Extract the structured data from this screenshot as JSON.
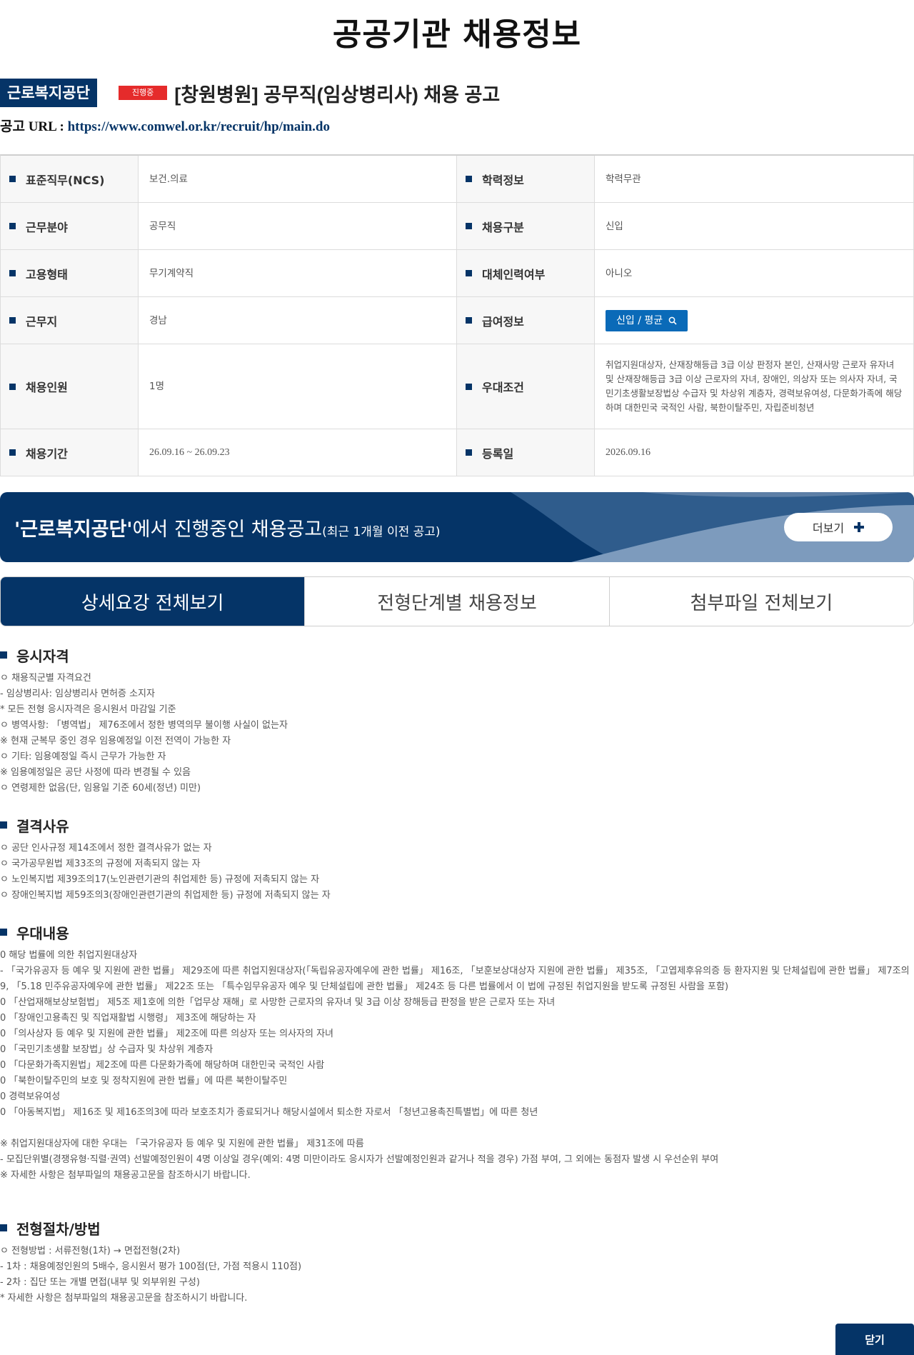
{
  "page_title": "공공기관 채용정보",
  "header": {
    "org_name": "근로복지공단",
    "status": "진행중",
    "job_title": "[창원병원] 공무직(임상병리사) 채용 공고",
    "url_label": "공고 URL : ",
    "url": "https://www.comwel.or.kr/recruit/hp/main.do"
  },
  "info": {
    "rows": [
      {
        "left_label": "표준직무(NCS)",
        "left_value": "보건.의료",
        "right_label": "학력정보",
        "right_value": "학력무관"
      },
      {
        "left_label": "근무분야",
        "left_value": "공무직",
        "right_label": "채용구분",
        "right_value": "신입"
      },
      {
        "left_label": "고용형태",
        "left_value": "무기계약직",
        "right_label": "대체인력여부",
        "right_value": "아니오"
      },
      {
        "left_label": "근무지",
        "left_value": "경남",
        "right_label": "급여정보",
        "right_value": "신입 / 평균"
      },
      {
        "left_label": "채용인원",
        "left_value": "1명",
        "right_label": "우대조건",
        "right_value": "취업지원대상자, 산재장해등급 3급 이상 판정자 본인, 산재사망 근로자 유자녀 및 산재장해등급 3급 이상 근로자의 자녀, 장애인, 의상자 또는 의사자 자녀, 국민기초생활보장법상 수급자 및 차상위 계층자, 경력보유여성, 다문화가족에 해당하며 대한민국 국적인 사람, 북한이탈주민, 자립준비청년"
      },
      {
        "left_label": "채용기간",
        "left_value": "26.09.16 ~ 26.09.23",
        "right_label": "등록일",
        "right_value": "2026.09.16"
      }
    ]
  },
  "banner": {
    "org_quoted": "'근로복지공단'",
    "text": "에서 진행중인 채용공고",
    "note": "(최근 1개월 이전 공고)",
    "more_label": "더보기"
  },
  "tabs": [
    {
      "label": "상세요강 전체보기",
      "active": true
    },
    {
      "label": "전형단계별 채용정보",
      "active": false
    },
    {
      "label": "첨부파일 전체보기",
      "active": false
    }
  ],
  "sections": {
    "qualification": {
      "title": "응시자격",
      "lines": [
        "ㅇ 채용직군별 자격요건",
        "- 임상병리사: 임상병리사 면허증 소지자",
        "* 모든 전형 응시자격은 응시원서 마감일 기준",
        "ㅇ 병역사항: 「병역법」 제76조에서 정한 병역의무 불이행 사실이 없는자",
        "※ 현재 군복무 중인 경우 임용예정일 이전 전역이 가능한 자",
        "ㅇ 기타: 임용예정일 즉시 근무가 가능한 자",
        "※ 임용예정일은 공단 사정에 따라 변경될 수 있음",
        "ㅇ 연령제한 없음(단, 임용일 기준 60세(정년) 미만)"
      ]
    },
    "disqualification": {
      "title": "결격사유",
      "lines": [
        "ㅇ 공단 인사규정 제14조에서 정한 결격사유가 없는 자",
        "ㅇ 국가공무원법 제33조의 규정에 저촉되지 않는 자",
        "ㅇ 노인복지법 제39조의17(노인관련기관의 취업제한 등) 규정에 저촉되지 않는 자",
        "ㅇ 장애인복지법 제59조의3(장애인관련기관의 취업제한 등) 규정에 저촉되지 않는 자"
      ]
    },
    "preference": {
      "title": "우대내용",
      "lines": [
        "0 해당 법률에 의한 취업지원대상자",
        "- 「국가유공자 등 예우 및 지원에 관한 법률」 제29조에 따른 취업지원대상자(「독립유공자예우에 관한 법률」 제16조, 「보훈보상대상자 지원에 관한 법률」 제35조, 「고엽제후유의증 등 환자지원 및 단체설립에 관한 법률」 제7조의9, 「5.18 민주유공자예우에 관한 법률」 제22조 또는 「특수임무유공자 예우 및 단체설립에 관한 법률」 제24조 등 다른 법률에서 이 법에 규정된 취업지원을 받도록 규정된 사람을 포함)",
        "0 「산업재해보상보험법」 제5조 제1호에 의한「업무상 재해」로 사망한 근로자의 유자녀 및 3급 이상 장해등급 판정을 받은 근로자 또는 자녀",
        "0 「장애인고용촉진 및 직업재활법 시행령」 제3조에 해당하는 자",
        "0 「의사상자 등 예우 및 지원에 관한 법률」 제2조에 따른 의상자 또는 의사자의 자녀",
        "0 「국민기초생활 보장법」상 수급자 및 차상위 계층자",
        "0 「다문화가족지원법」제2조에 따른 다문화가족에 해당하며 대한민국 국적인 사람",
        "0 「북한이탈주민의 보호 및 정착지원에 관한 법률」에 따른 북한이탈주민",
        "0 경력보유여성",
        "0 「아동복지법」 제16조 및 제16조의3에 따라 보호조치가 종료되거나 해당시설에서 퇴소한 자로서 「청년고용촉진특별법」에 따른 청년",
        "",
        "※ 취업지원대상자에 대한 우대는 「국가유공자 등 예우 및 지원에 관한 법률」 제31조에 따름",
        "- 모집단위별(경쟁유형·직렬·권역) 선발예정인원이 4명 이상일 경우(예외: 4명 미만이라도 응시자가 선발예정인원과 같거나 적을 경우) 가점 부여, 그 외에는 동점자 발생 시 우선순위 부여",
        "※ 자세한 사항은 첨부파일의 채용공고문을 참조하시기 바랍니다."
      ]
    },
    "procedure": {
      "title": "전형절차/방법",
      "lines": [
        "ㅇ 전형방법 : 서류전형(1차) → 면접전형(2차)",
        "- 1차 : 채용예정인원의 5배수, 응시원서 평가 100점(단, 가점 적용시 110점)",
        "- 2차 : 집단 또는 개별 면접(내부 및 외부위원 구성)",
        "* 자세한 사항은 첨부파일의 채용공고문을 참조하시기 바랍니다."
      ]
    }
  },
  "close_label": "닫기",
  "colors": {
    "primary": "#053467",
    "status_red": "#e52b2b",
    "salary_blue": "#0a6ab8"
  },
  "icons": [
    "search-icon",
    "plus-icon"
  ]
}
